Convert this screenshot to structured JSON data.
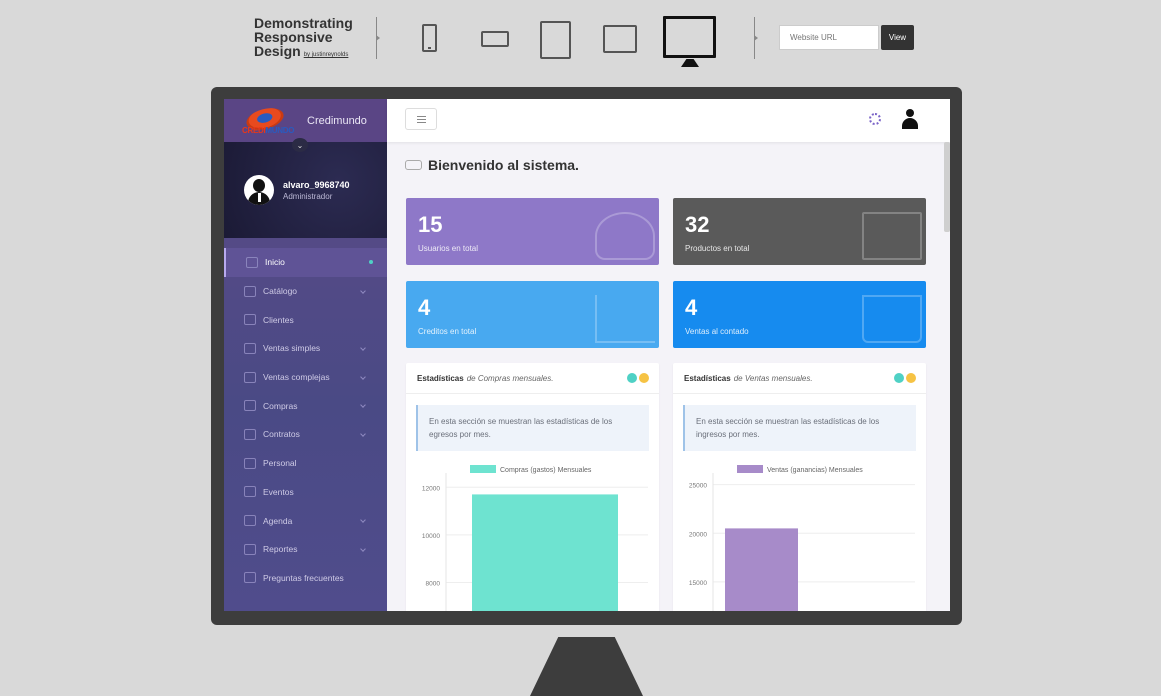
{
  "topbar": {
    "brand_line1": "Demonstrating",
    "brand_line2": "Responsive",
    "brand_line3": "Design",
    "brand_by": "by justinreynolds",
    "url_placeholder": "Website URL",
    "view_label": "View"
  },
  "app": {
    "name": "Credimundo",
    "logo_text_a": "CREDI",
    "logo_text_b": "MUNDO"
  },
  "user": {
    "name": "alvaro_9968740",
    "role": "Administrador"
  },
  "sidebar": {
    "items": [
      {
        "label": "Inicio"
      },
      {
        "label": "Catálogo"
      },
      {
        "label": "Clientes"
      },
      {
        "label": "Ventas simples"
      },
      {
        "label": "Ventas complejas"
      },
      {
        "label": "Compras"
      },
      {
        "label": "Contratos"
      },
      {
        "label": "Personal"
      },
      {
        "label": "Eventos"
      },
      {
        "label": "Agenda"
      },
      {
        "label": "Reportes"
      },
      {
        "label": "Preguntas frecuentes"
      }
    ]
  },
  "main": {
    "welcome": "Bienvenido al sistema.",
    "tiles": [
      {
        "value": "15",
        "label": "Usuarios en total",
        "color": "#8e78c8"
      },
      {
        "value": "32",
        "label": "Productos en total",
        "color": "#5a5a5a"
      },
      {
        "value": "4",
        "label": "Creditos en total",
        "color": "#48a9f0"
      },
      {
        "value": "4",
        "label": "Ventas al contado",
        "color": "#168bef"
      }
    ],
    "cards": [
      {
        "title_bold": "Estadísticas",
        "title_em": "de Compras mensuales.",
        "info": "En esta sección se muestran las estadísticas de los egresos por mes."
      },
      {
        "title_bold": "Estadísticas",
        "title_em": "de Ventas mensuales.",
        "info": "En esta sección se muestran las estadísticas de los ingresos por mes."
      }
    ]
  },
  "chart_data": [
    {
      "type": "bar",
      "series": [
        {
          "name": "Compras (gastos) Mensuales",
          "values": [
            11700
          ],
          "color": "#6ee3d0"
        }
      ],
      "yticks": [
        12000,
        10000,
        8000
      ],
      "ylim_visible": [
        6800,
        12600
      ]
    },
    {
      "type": "bar",
      "series": [
        {
          "name": "Ventas (ganancias) Mensuales",
          "values": [
            20500
          ],
          "color": "#a78bc9"
        }
      ],
      "yticks": [
        25000,
        20000,
        15000
      ],
      "ylim_visible": [
        12000,
        26200
      ]
    }
  ]
}
